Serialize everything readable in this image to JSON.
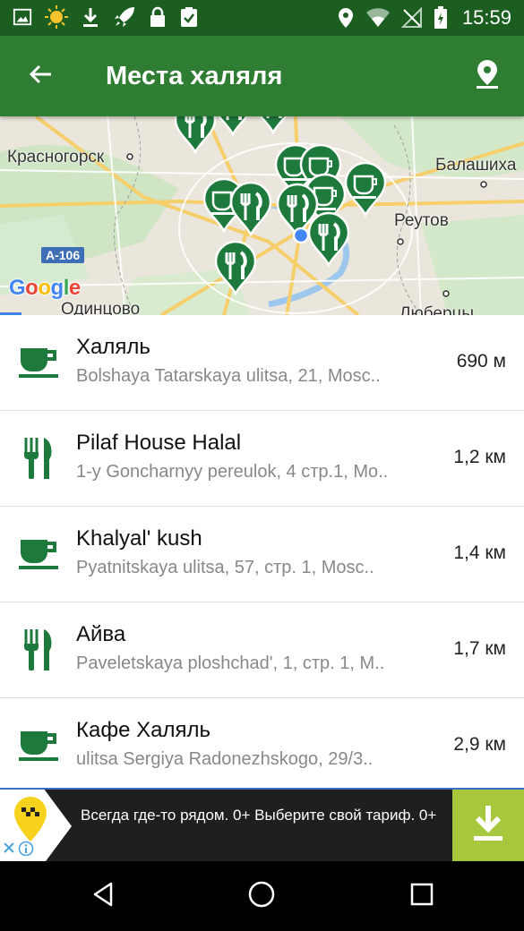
{
  "status_bar": {
    "time": "15:59",
    "left_icons": [
      "image-icon",
      "sun-icon",
      "download-icon",
      "rocket-icon",
      "lock-icon",
      "clipboard-check-icon"
    ],
    "right_icons": [
      "location-icon",
      "wifi-icon",
      "no-signal-icon",
      "battery-charging-icon"
    ]
  },
  "app_bar": {
    "title": "Места халяля",
    "back_icon": "arrow-back-icon",
    "action_icon": "map-pin-icon"
  },
  "map": {
    "labels": {
      "krasnogorsk": "Красногорск",
      "balashikha": "Балашиха",
      "reutov": "Реутов",
      "odintsovo": "Одинцово",
      "lyubertsy": "Люберцы"
    },
    "highway": "A-106",
    "google": "Google",
    "marker_color": "#1e7a3c"
  },
  "places": [
    {
      "name": "Халяль",
      "address": "Bolshaya Tatarskaya ulitsa, 21, Mosc..",
      "distance": "690 м",
      "icon": "cafe-cup-icon"
    },
    {
      "name": "Pilaf House Halal",
      "address": "1-y Goncharnyy pereulok, 4 стр.1, Mo..",
      "distance": "1,2 км",
      "icon": "restaurant-icon"
    },
    {
      "name": "Khalyal' kush",
      "address": "Pyatnitskaya ulitsa, 57, стр. 1, Mosc..",
      "distance": "1,4 км",
      "icon": "cafe-cup-icon"
    },
    {
      "name": "Айва",
      "address": "Paveletskaya ploshchad', 1, стр. 1, M..",
      "distance": "1,7 км",
      "icon": "restaurant-icon"
    },
    {
      "name": "Кафе Халяль",
      "address": "ulitsa Sergiya Radonezhskogo, 29/3..",
      "distance": "2,9 км",
      "icon": "cafe-cup-icon"
    }
  ],
  "ad": {
    "text": "Всегда где-то рядом. 0+ Выберите свой тариф. 0+",
    "download_icon": "download-icon"
  },
  "nav_bar": {
    "icons": [
      "back-triangle-icon",
      "home-circle-icon",
      "recents-square-icon"
    ]
  },
  "colors": {
    "status_bar": "#1b5e20",
    "app_bar": "#2e7d32",
    "icon_green": "#1e7a3c",
    "ad_download_bg": "#a7c83c"
  }
}
